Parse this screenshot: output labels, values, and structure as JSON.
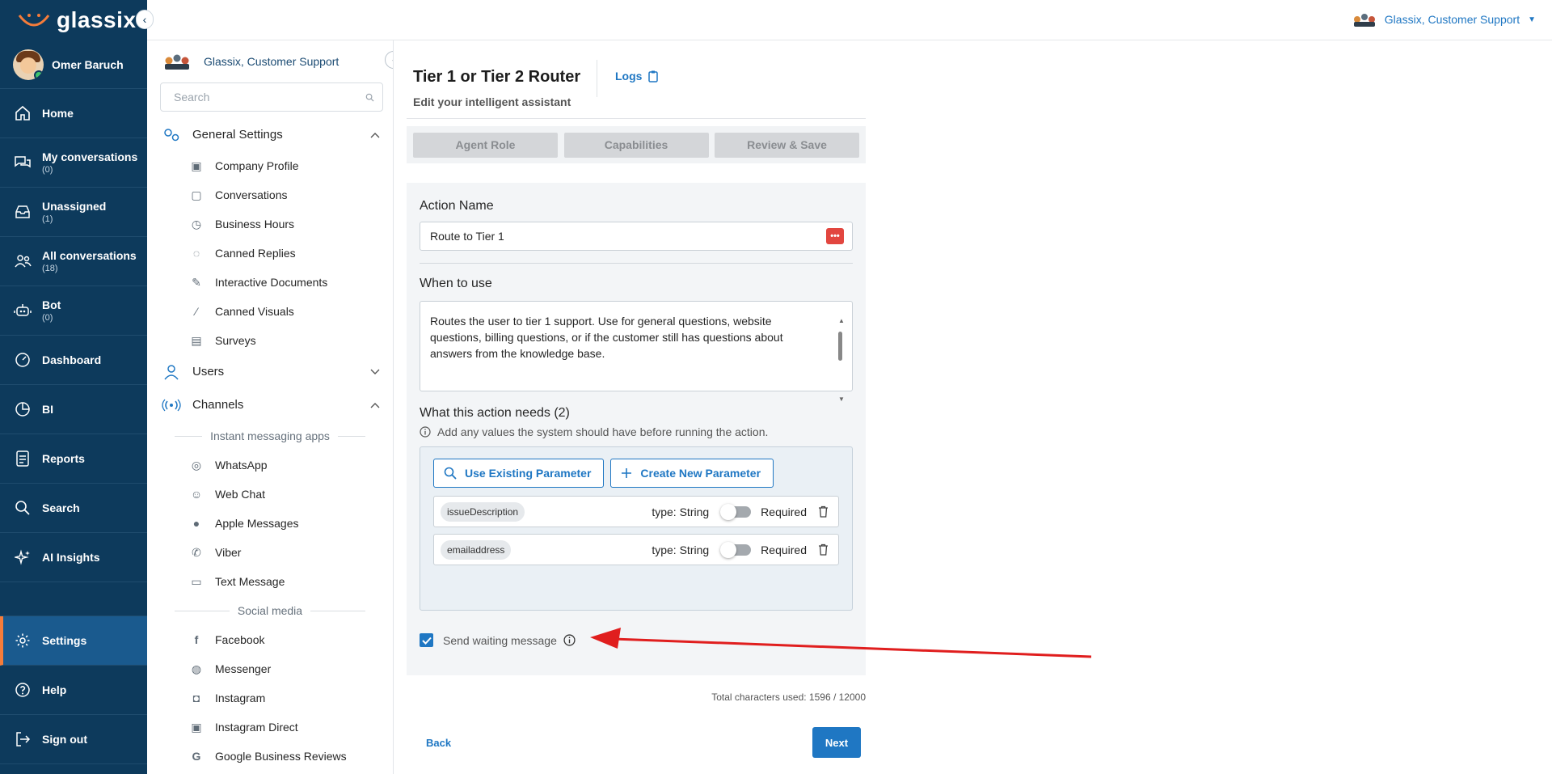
{
  "app": {
    "brand": "glassix"
  },
  "topbar": {
    "account_name": "Glassix, Customer Support"
  },
  "leftnav": {
    "user_name": "Omer Baruch",
    "items": [
      {
        "label": "Home",
        "count": "",
        "icon": "home-icon"
      },
      {
        "label": "My conversations",
        "count": "(0)",
        "icon": "chat-bubbles-icon"
      },
      {
        "label": "Unassigned",
        "count": "(1)",
        "icon": "inbox-icon"
      },
      {
        "label": "All conversations",
        "count": "(18)",
        "icon": "users-icon"
      },
      {
        "label": "Bot",
        "count": "(0)",
        "icon": "robot-icon"
      },
      {
        "label": "Dashboard",
        "count": "",
        "icon": "gauge-icon"
      },
      {
        "label": "BI",
        "count": "",
        "icon": "pie-chart-icon"
      },
      {
        "label": "Reports",
        "count": "",
        "icon": "report-icon"
      },
      {
        "label": "Search",
        "count": "",
        "icon": "search-icon"
      },
      {
        "label": "AI Insights",
        "count": "",
        "icon": "sparkle-icon"
      },
      {
        "label": "Settings",
        "count": "",
        "icon": "gear-icon"
      },
      {
        "label": "Help",
        "count": "",
        "icon": "help-icon"
      },
      {
        "label": "Sign out",
        "count": "",
        "icon": "sign-out-icon"
      }
    ]
  },
  "settings": {
    "account_name": "Glassix, Customer Support",
    "search_placeholder": "Search",
    "general": {
      "label": "General Settings",
      "items": [
        "Company Profile",
        "Conversations",
        "Business Hours",
        "Canned Replies",
        "Interactive Documents",
        "Canned Visuals",
        "Surveys"
      ]
    },
    "users_label": "Users",
    "channels": {
      "label": "Channels",
      "group1": "Instant messaging apps",
      "group1_items": [
        "WhatsApp",
        "Web Chat",
        "Apple Messages",
        "Viber",
        "Text Message"
      ],
      "group2": "Social media",
      "group2_items": [
        "Facebook",
        "Messenger",
        "Instagram",
        "Instagram Direct",
        "Google Business Reviews"
      ]
    }
  },
  "main": {
    "title": "Tier 1 or Tier 2 Router",
    "logs_label": "Logs",
    "subtitle": "Edit your intelligent assistant",
    "steps": [
      "Agent Role",
      "Capabilities",
      "Review & Save"
    ],
    "action_name_label": "Action Name",
    "action_name_value": "Route to Tier 1",
    "when_label": "When to use",
    "when_text": "Routes the user to tier 1 support. Use for general questions, website questions, billing questions, or if the customer still has questions about answers from the knowledge base.",
    "needs_label": "What this action needs (2)",
    "needs_hint": "Add any values the system should have before running the action.",
    "use_existing_label": "Use Existing Parameter",
    "create_new_label": "Create New Parameter",
    "params": [
      {
        "name": "issueDescription",
        "type": "type: String",
        "required": "Required",
        "required_on": false
      },
      {
        "name": "emailaddress",
        "type": "type: String",
        "required": "Required",
        "required_on": false
      }
    ],
    "waiting_label": "Send waiting message",
    "waiting_checked": true,
    "chars_used": "Total characters used: 1596 / 12000",
    "back_label": "Back",
    "next_label": "Next"
  },
  "colors": {
    "nav_bg": "#0d3a5c",
    "accent": "#1f77c3",
    "active_marker": "#f57c3a",
    "annotation_arrow": "#e01e1e"
  }
}
